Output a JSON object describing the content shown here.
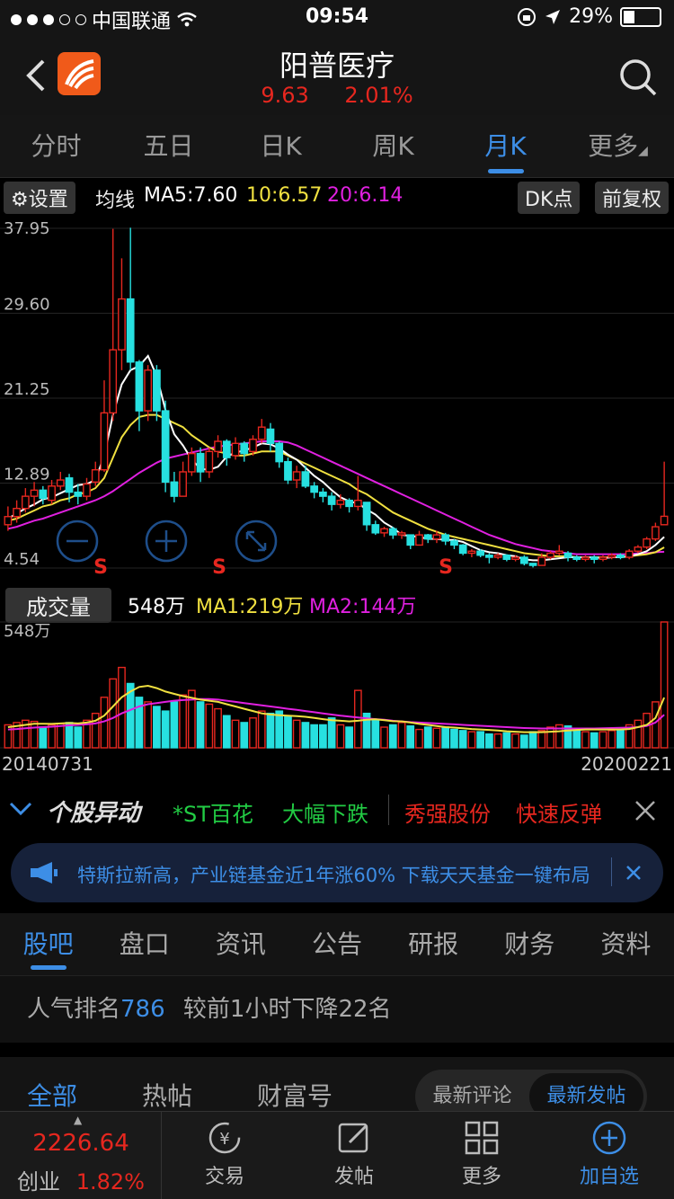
{
  "status_bar": {
    "carrier": "中国联通",
    "time": "09:54",
    "battery": "29%"
  },
  "header": {
    "stock_name": "阳普医疗",
    "price": "9.63",
    "change_pct": "2.01%"
  },
  "period_tabs": [
    "分时",
    "五日",
    "日K",
    "周K",
    "月K",
    "更多"
  ],
  "active_period": "月K",
  "ma_bar": {
    "settings": "设置",
    "label": "均线",
    "ma5": "MA5:7.60",
    "ma10": "10:6.57",
    "ma20": "20:6.14",
    "dk_button": "DK点",
    "adjust_button": "前复权"
  },
  "price_axis": [
    "37.95",
    "29.60",
    "21.25",
    "12.89",
    "4.54"
  ],
  "volume_bar": {
    "label": "成交量",
    "value": "548万",
    "ma1": "MA1:219万",
    "ma2": "MA2:144万",
    "axis_max": "548万"
  },
  "dates": {
    "start": "20140731",
    "end": "20200221"
  },
  "signals": [
    "S",
    "S",
    "S"
  ],
  "alert": {
    "title": "个股异动",
    "items": [
      {
        "text": "*ST百花",
        "color": "#22cc44"
      },
      {
        "text": "大幅下跌",
        "color": "#22cc44"
      },
      {
        "text": "秀强股份",
        "color": "#e6271f"
      },
      {
        "text": "快速反弹",
        "color": "#e6271f"
      }
    ]
  },
  "banner": {
    "text": "特斯拉新高，产业链基金近1年涨60% 下载天天基金一键布局"
  },
  "sub_tabs": [
    "股吧",
    "盘口",
    "资讯",
    "公告",
    "研报",
    "财务",
    "资料"
  ],
  "rank": {
    "prefix": "人气排名",
    "number": "786",
    "suffix": "较前1小时下降22名"
  },
  "post_tabs": [
    "全部",
    "热帖",
    "财富号"
  ],
  "post_sort": [
    "最新评论",
    "最新发帖"
  ],
  "bottom_nav": {
    "index_value": "2226.64",
    "index_name": "创业",
    "index_change": "1.82%",
    "items": [
      "交易",
      "发帖",
      "更多",
      "加自选"
    ]
  },
  "colors": {
    "up": "#e6271f",
    "down": "#27e0e0",
    "accent": "#3d8ee6",
    "ma5": "#ffffff",
    "ma10": "#f0e040",
    "ma20": "#e020e0"
  },
  "chart_data": {
    "type": "candlestick",
    "period": "monthly",
    "y_range": [
      4.54,
      37.95
    ],
    "candles": [
      [
        8.8,
        9.6,
        10.6,
        8.2
      ],
      [
        9.6,
        10.4,
        11.2,
        9.0
      ],
      [
        10.4,
        11.6,
        12.4,
        10.0
      ],
      [
        11.6,
        12.2,
        13.0,
        10.6
      ],
      [
        12.2,
        11.4,
        12.6,
        10.8
      ],
      [
        11.2,
        12.6,
        13.2,
        10.8
      ],
      [
        12.6,
        13.2,
        14.0,
        12.2
      ],
      [
        13.4,
        12.0,
        13.8,
        11.0
      ],
      [
        12.0,
        11.6,
        12.8,
        10.8
      ],
      [
        11.6,
        12.8,
        13.4,
        11.2
      ],
      [
        13.0,
        14.2,
        15.0,
        12.6
      ],
      [
        14.2,
        19.8,
        23.0,
        14.0
      ],
      [
        19.8,
        26.0,
        37.9,
        19.0
      ],
      [
        26.0,
        31.0,
        35.0,
        24.0
      ],
      [
        31.0,
        24.8,
        38.0,
        24.0
      ],
      [
        24.8,
        20.0,
        25.0,
        18.0
      ],
      [
        20.0,
        24.0,
        24.5,
        19.0
      ],
      [
        24.0,
        20.0,
        24.5,
        19.0
      ],
      [
        20.0,
        13.0,
        21.0,
        12.0
      ],
      [
        13.0,
        11.6,
        14.0,
        11.0
      ],
      [
        11.6,
        14.0,
        15.0,
        11.6
      ],
      [
        14.0,
        15.8,
        16.4,
        13.6
      ],
      [
        15.8,
        14.0,
        16.4,
        13.0
      ],
      [
        14.0,
        16.0,
        16.4,
        13.4
      ],
      [
        16.0,
        17.0,
        17.6,
        15.4
      ],
      [
        17.0,
        15.4,
        17.2,
        14.6
      ],
      [
        15.6,
        16.8,
        17.4,
        15.2
      ],
      [
        16.8,
        15.8,
        17.0,
        15.0
      ],
      [
        16.0,
        17.2,
        17.6,
        15.6
      ],
      [
        17.2,
        18.4,
        19.2,
        16.8
      ],
      [
        18.2,
        16.8,
        18.8,
        16.0
      ],
      [
        16.8,
        15.0,
        17.0,
        14.4
      ],
      [
        15.0,
        13.2,
        15.4,
        12.8
      ],
      [
        13.2,
        14.0,
        14.6,
        12.4
      ],
      [
        14.0,
        12.6,
        14.6,
        12.4
      ],
      [
        12.6,
        12.0,
        13.0,
        11.4
      ],
      [
        12.0,
        11.6,
        12.4,
        11.0
      ],
      [
        11.6,
        10.8,
        12.0,
        10.2
      ],
      [
        10.8,
        11.2,
        11.8,
        10.4
      ],
      [
        11.2,
        10.6,
        11.4,
        10.0
      ],
      [
        10.6,
        11.2,
        13.6,
        10.2
      ],
      [
        11.0,
        8.8,
        11.0,
        8.2
      ],
      [
        8.8,
        8.0,
        9.2,
        7.8
      ],
      [
        8.0,
        8.4,
        8.6,
        7.6
      ],
      [
        8.4,
        7.8,
        8.6,
        7.4
      ],
      [
        7.8,
        8.0,
        8.2,
        7.4
      ],
      [
        7.8,
        6.8,
        7.8,
        6.4
      ],
      [
        6.8,
        7.8,
        8.2,
        6.8
      ],
      [
        7.8,
        7.4,
        7.9,
        7.0
      ],
      [
        7.4,
        7.8,
        8.2,
        7.0
      ],
      [
        7.8,
        7.2,
        8.0,
        6.8
      ],
      [
        7.2,
        6.8,
        7.4,
        6.4
      ],
      [
        6.8,
        6.0,
        6.9,
        5.8
      ],
      [
        6.0,
        6.2,
        6.4,
        5.6
      ],
      [
        6.2,
        5.8,
        6.4,
        5.6
      ],
      [
        5.8,
        5.6,
        6.0,
        5.0
      ],
      [
        5.6,
        5.8,
        6.0,
        5.4
      ],
      [
        5.8,
        5.4,
        5.9,
        5.2
      ],
      [
        5.4,
        5.6,
        5.8,
        5.2
      ],
      [
        5.6,
        5.0,
        5.8,
        4.8
      ],
      [
        5.0,
        4.8,
        5.0,
        4.6
      ],
      [
        4.8,
        5.6,
        6.0,
        4.8
      ],
      [
        5.6,
        6.0,
        6.2,
        5.4
      ],
      [
        6.0,
        6.2,
        6.8,
        5.8
      ],
      [
        6.0,
        5.6,
        6.2,
        5.2
      ],
      [
        5.6,
        5.4,
        5.8,
        5.2
      ],
      [
        5.4,
        5.6,
        5.8,
        5.2
      ],
      [
        5.6,
        5.4,
        5.8,
        5.0
      ],
      [
        5.4,
        5.6,
        5.8,
        5.2
      ],
      [
        5.6,
        5.8,
        6.0,
        5.4
      ],
      [
        5.8,
        5.6,
        6.0,
        5.4
      ],
      [
        5.6,
        6.2,
        6.4,
        5.4
      ],
      [
        6.2,
        6.6,
        6.8,
        6.0
      ],
      [
        6.6,
        7.4,
        7.6,
        6.4
      ],
      [
        7.4,
        8.6,
        9.0,
        7.2
      ],
      [
        8.8,
        9.63,
        15.0,
        8.8
      ]
    ],
    "ma5": [
      9.4,
      9.9,
      10.4,
      10.8,
      11.3,
      11.5,
      11.9,
      12.3,
      12.7,
      12.8,
      13.2,
      15.6,
      19.6,
      22.6,
      24.0,
      24.4,
      25.4,
      23.4,
      20.1,
      17.7,
      16.6,
      15.2,
      14.3,
      14.2,
      14.5,
      15.5,
      15.9,
      16.1,
      16.4,
      16.8,
      16.7,
      16.3,
      15.7,
      15.2,
      14.4,
      13.6,
      13.0,
      12.2,
      11.5,
      11.1,
      10.9,
      10.3,
      9.8,
      9.0,
      8.5,
      7.8,
      7.7,
      7.6,
      7.4,
      7.4,
      7.3,
      7.3,
      7.1,
      6.7,
      6.3,
      6.1,
      6.0,
      5.8,
      5.7,
      5.4,
      5.3,
      5.3,
      5.4,
      5.5,
      5.6,
      5.6,
      5.6,
      5.6,
      5.5,
      5.6,
      5.6,
      5.7,
      5.9,
      6.2,
      6.8,
      7.6
    ],
    "ma10": [
      9.2,
      9.4,
      9.8,
      10.2,
      10.6,
      10.8,
      11.2,
      11.4,
      11.8,
      12.0,
      12.4,
      13.4,
      15.4,
      17.4,
      18.6,
      19.4,
      19.6,
      19.6,
      19.2,
      18.8,
      18.4,
      17.6,
      17.0,
      16.4,
      16.0,
      15.8,
      15.6,
      15.6,
      15.8,
      16.0,
      16.0,
      16.0,
      15.6,
      15.2,
      14.8,
      14.4,
      14.0,
      13.6,
      13.2,
      12.8,
      12.2,
      11.8,
      11.2,
      10.6,
      10.0,
      9.6,
      9.2,
      8.8,
      8.4,
      8.1,
      7.8,
      7.6,
      7.4,
      7.2,
      7.0,
      6.8,
      6.6,
      6.4,
      6.2,
      6.0,
      5.9,
      5.8,
      5.7,
      5.7,
      5.7,
      5.6,
      5.6,
      5.6,
      5.6,
      5.6,
      5.6,
      5.7,
      5.8,
      5.9,
      6.1,
      6.57
    ],
    "ma20": [
      8.4,
      8.6,
      8.9,
      9.2,
      9.4,
      9.7,
      10.0,
      10.3,
      10.6,
      10.9,
      11.2,
      11.6,
      12.1,
      12.7,
      13.3,
      13.9,
      14.4,
      14.9,
      15.3,
      15.5,
      15.7,
      15.9,
      16.1,
      16.3,
      16.5,
      16.6,
      16.7,
      16.8,
      16.9,
      17.0,
      17.0,
      17.0,
      16.9,
      16.6,
      16.2,
      15.8,
      15.4,
      15.0,
      14.6,
      14.2,
      13.8,
      13.4,
      13.0,
      12.6,
      12.2,
      11.8,
      11.4,
      11.0,
      10.6,
      10.2,
      9.8,
      9.4,
      9.0,
      8.6,
      8.2,
      7.8,
      7.5,
      7.2,
      6.9,
      6.7,
      6.5,
      6.3,
      6.2,
      6.1,
      6.0,
      5.9,
      5.9,
      5.9,
      5.9,
      5.9,
      5.9,
      5.9,
      6.0,
      6.0,
      6.1,
      6.14
    ],
    "volume": [
      100,
      110,
      120,
      115,
      90,
      100,
      105,
      110,
      90,
      120,
      150,
      220,
      300,
      350,
      280,
      220,
      200,
      180,
      160,
      200,
      230,
      250,
      200,
      190,
      170,
      140,
      120,
      110,
      130,
      160,
      150,
      160,
      140,
      120,
      110,
      100,
      100,
      130,
      100,
      90,
      250,
      150,
      120,
      90,
      100,
      110,
      95,
      80,
      90,
      85,
      90,
      80,
      75,
      70,
      70,
      60,
      60,
      65,
      60,
      55,
      70,
      75,
      90,
      100,
      95,
      85,
      70,
      65,
      70,
      75,
      80,
      100,
      120,
      150,
      200,
      548
    ],
    "vol_ma1": [
      90,
      95,
      100,
      105,
      105,
      104,
      106,
      108,
      106,
      110,
      118,
      140,
      180,
      220,
      245,
      265,
      270,
      260,
      245,
      235,
      225,
      218,
      210,
      205,
      200,
      190,
      180,
      170,
      160,
      150,
      145,
      142,
      140,
      138,
      135,
      130,
      125,
      120,
      118,
      115,
      118,
      122,
      124,
      120,
      116,
      115,
      110,
      104,
      100,
      95,
      90,
      88,
      85,
      82,
      80,
      78,
      75,
      72,
      70,
      68,
      68,
      68,
      70,
      72,
      75,
      78,
      80,
      80,
      80,
      80,
      80,
      82,
      90,
      100,
      130,
      219
    ],
    "vol_ma2": [
      80,
      82,
      85,
      88,
      90,
      92,
      95,
      98,
      100,
      102,
      106,
      115,
      130,
      150,
      165,
      180,
      190,
      195,
      200,
      205,
      208,
      210,
      212,
      212,
      210,
      205,
      200,
      195,
      190,
      185,
      180,
      175,
      170,
      165,
      160,
      155,
      150,
      145,
      140,
      136,
      132,
      128,
      125,
      122,
      118,
      115,
      112,
      110,
      108,
      106,
      104,
      102,
      100,
      98,
      96,
      94,
      92,
      90,
      88,
      86,
      85,
      84,
      84,
      84,
      84,
      84,
      84,
      84,
      85,
      86,
      87,
      88,
      90,
      95,
      110,
      144
    ],
    "vol_max": 548
  }
}
